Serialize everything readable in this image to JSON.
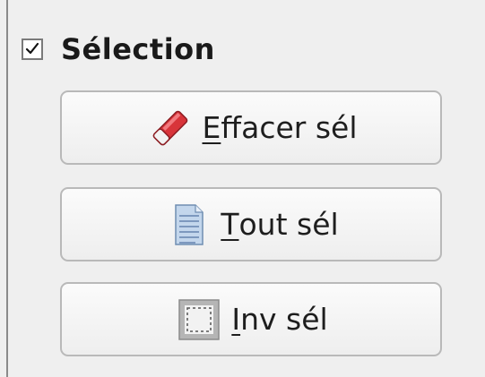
{
  "selection_group": {
    "title": "Sélection",
    "checked": true,
    "icon": "checkbox-checked-icon"
  },
  "buttons": [
    {
      "mnemonic": "E",
      "rest": "ffacer sél",
      "icon": "eraser-icon",
      "icon_color": "#d8343a"
    },
    {
      "mnemonic": "T",
      "rest": "out sél",
      "icon": "document-icon",
      "icon_color": "#9bb6d6"
    },
    {
      "mnemonic": "I",
      "rest": "nv sél",
      "icon": "inverse-selection-icon",
      "icon_color": "#a9a9a9"
    }
  ]
}
